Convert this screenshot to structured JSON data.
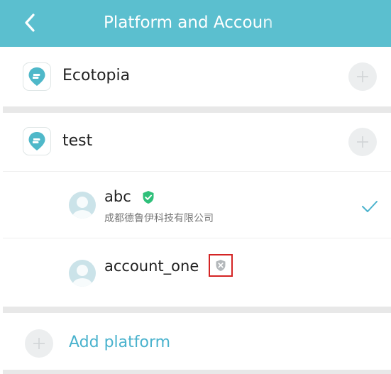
{
  "header": {
    "title": "Platform and Accoun"
  },
  "platforms": [
    {
      "name": "Ecotopia",
      "icon": "platform-app-icon"
    },
    {
      "name": "test",
      "icon": "platform-app-icon",
      "accounts": [
        {
          "name": "abc",
          "company": "成都德鲁伊科技有限公司",
          "verified": true,
          "selected": true
        },
        {
          "name": "account_one",
          "company": "",
          "verified": false,
          "selected": false
        }
      ]
    }
  ],
  "add_platform": {
    "label": "Add platform"
  },
  "colors": {
    "header_bg": "#5bbfcf",
    "accent": "#49b2cd",
    "verified_badge": "#2fc07a",
    "unverified_badge": "#b4b8bb",
    "highlight_box": "#d42424"
  }
}
